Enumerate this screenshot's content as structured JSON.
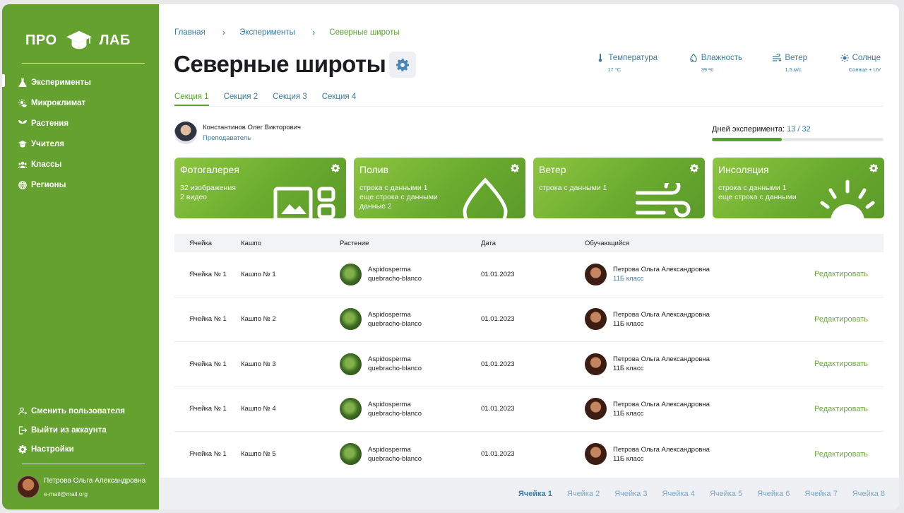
{
  "brand": {
    "left": "ПРО",
    "right": "ЛАБ"
  },
  "sidebar": {
    "items": [
      {
        "label": "Эксперименты",
        "icon": "flask-icon"
      },
      {
        "label": "Микроклимат",
        "icon": "sun-cloud-icon"
      },
      {
        "label": "Растения",
        "icon": "sprout-icon"
      },
      {
        "label": "Учителя",
        "icon": "graduation-cap-icon"
      },
      {
        "label": "Классы",
        "icon": "users-icon"
      },
      {
        "label": "Регионы",
        "icon": "globe-icon"
      }
    ],
    "bottom": [
      {
        "label": "Сменить пользователя",
        "icon": "switch-user-icon"
      },
      {
        "label": "Выйти из аккаунта",
        "icon": "logout-icon"
      },
      {
        "label": "Настройки",
        "icon": "gear-icon"
      }
    ],
    "user": {
      "name": "Петрова Ольга Александровна",
      "email": "e-mail@mail.org"
    }
  },
  "breadcrumb": [
    "Главная",
    "Эксперименты",
    "Северные широты"
  ],
  "title": "Северные широты",
  "weather": [
    {
      "label": "Температура",
      "value": "17 °C",
      "icon": "thermometer-icon"
    },
    {
      "label": "Влажность",
      "value": "39 %",
      "icon": "droplet-icon"
    },
    {
      "label": "Ветер",
      "value": "1.5 м/с",
      "icon": "wind-icon"
    },
    {
      "label": "Солнце",
      "value": "Солнце + UV",
      "icon": "sun-icon"
    }
  ],
  "tabs": [
    "Секция 1",
    "Секция 2",
    "Секция 3",
    "Секция 4"
  ],
  "teacher": {
    "name": "Константинов Олег Викторович",
    "role": "Преподаватель"
  },
  "days": {
    "label": "Дней эксперимента:",
    "value": "13 / 32",
    "progress": 0.40625
  },
  "cards": [
    {
      "title": "Фотогалерея",
      "lines": [
        "32 изображения",
        "2 видео"
      ],
      "icon": "gallery-icon"
    },
    {
      "title": "Полив",
      "lines": [
        "строка с данными 1",
        "еще строка с данными",
        "данные 2"
      ],
      "icon": "water-drop-icon"
    },
    {
      "title": "Ветер",
      "lines": [
        "строка с данными 1"
      ],
      "icon": "wind-icon"
    },
    {
      "title": "Инсоляция",
      "lines": [
        "строка с данными 1",
        "еще строка с данными"
      ],
      "icon": "sun-icon"
    }
  ],
  "table": {
    "headers": [
      "Ячейка",
      "Кашпо",
      "Растение",
      "Дата",
      "Обучающийся"
    ],
    "rows": [
      {
        "cell": "Ячейка № 1",
        "pot": "Кашпо № 1",
        "plant1": "Aspidosperma",
        "plant2": "quebracho-blanco",
        "date": "01.01.2023",
        "student": "Петрова Ольга Александровна",
        "cls": "11Б класс",
        "action": "Редактировать"
      },
      {
        "cell": "Ячейка № 1",
        "pot": "Кашпо № 2",
        "plant1": "Aspidosperma",
        "plant2": "quebracho-blanco",
        "date": "01.01.2023",
        "student": "Петрова Ольга Александровна",
        "cls": "11Б класс",
        "action": "Редактировать"
      },
      {
        "cell": "Ячейка № 1",
        "pot": "Кашпо № 3",
        "plant1": "Aspidosperma",
        "plant2": "quebracho-blanco",
        "date": "01.01.2023",
        "student": "Петрова Ольга Александровна",
        "cls": "11Б класс",
        "action": "Редактировать"
      },
      {
        "cell": "Ячейка № 1",
        "pot": "Кашпо № 4",
        "plant1": "Aspidosperma",
        "plant2": "quebracho-blanco",
        "date": "01.01.2023",
        "student": "Петрова Ольга Александровна",
        "cls": "11Б класс",
        "action": "Редактировать"
      },
      {
        "cell": "Ячейка № 1",
        "pot": "Кашпо № 5",
        "plant1": "Aspidosperma",
        "plant2": "quebracho-blanco",
        "date": "01.01.2023",
        "student": "Петрова Ольга Александровна",
        "cls": "11Б класс",
        "action": "Редактировать"
      }
    ]
  },
  "pager": [
    "Ячейка 1",
    "Ячейка 2",
    "Ячейка 3",
    "Ячейка 4",
    "Ячейка 5",
    "Ячейка 6",
    "Ячейка 7",
    "Ячейка 8"
  ],
  "colors": {
    "accent_green": "#64a12f",
    "link_blue": "#3a7ca5"
  }
}
